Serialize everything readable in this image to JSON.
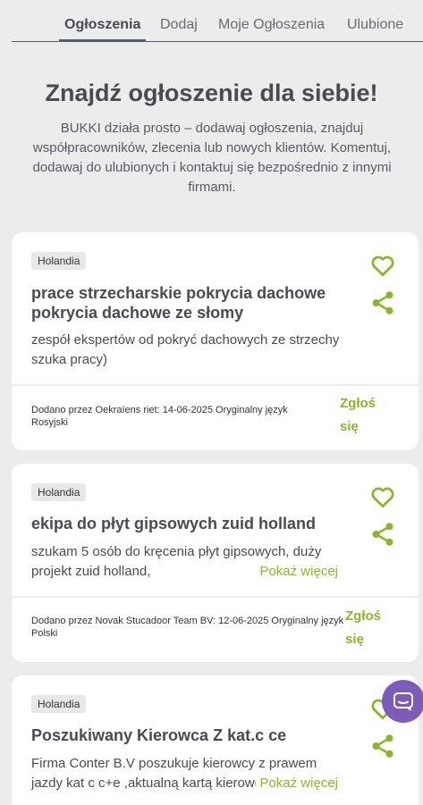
{
  "nav": {
    "tabs": [
      {
        "label": "Ogłoszenia"
      },
      {
        "label": "Dodaj"
      },
      {
        "label": "Moje Ogłoszenia"
      },
      {
        "label": "Ulubione"
      }
    ]
  },
  "hero": {
    "title": "Znajdź ogłoszenie dla siebie!",
    "description": "BUKKI działa prosto – dodawaj ogłoszenia, znajduj współpracowników, zlecenia lub nowych klientów. Komentuj, dodawaj do ulubionych i kontaktuj się bezpośrednio z innymi firmami."
  },
  "listings": [
    {
      "badge": "Holandia",
      "title": "prace strzecharskie pokrycia dachowe pokrycia dachowe ze słomy",
      "description": "zespół ekspertów od pokryć dachowych ze strzechy szuka pracy)",
      "meta": "Dodano przez Oekraïens riet: 14-06-2025 Oryginalny język Rosyjski",
      "report": "Zgłoś się"
    },
    {
      "badge": "Holandia",
      "title": "ekipa do płyt gipsowych zuid holland",
      "description_line1": "szukam 5 osób do kręcenia płyt gipsowych, duży",
      "description_line2": "projekt zuid holland,",
      "show_more": "Pokaż więcej",
      "meta": "Dodano przez Novak Stucadoor Team BV: 12-06-2025 Oryginalny język Polski",
      "report": "Zgłoś się"
    },
    {
      "badge": "Holandia",
      "title": "Poszukiwany Kierowca Z kat.c ce",
      "description_line1": "Firma Conter B.V poszukuje kierowcy z prawem",
      "description_line2": "jazdy kat c c+e ,aktualną kartą kierowcy",
      "show_more": "Pokaż więcej"
    }
  ],
  "icons": {
    "favorite": "heart-outline-icon",
    "share": "share-icon",
    "chat": "chat-bubble-icon"
  },
  "colors": {
    "accent_green": "#8ab62e",
    "chat_purple": "#7d5bb8",
    "background": "#ececec"
  }
}
